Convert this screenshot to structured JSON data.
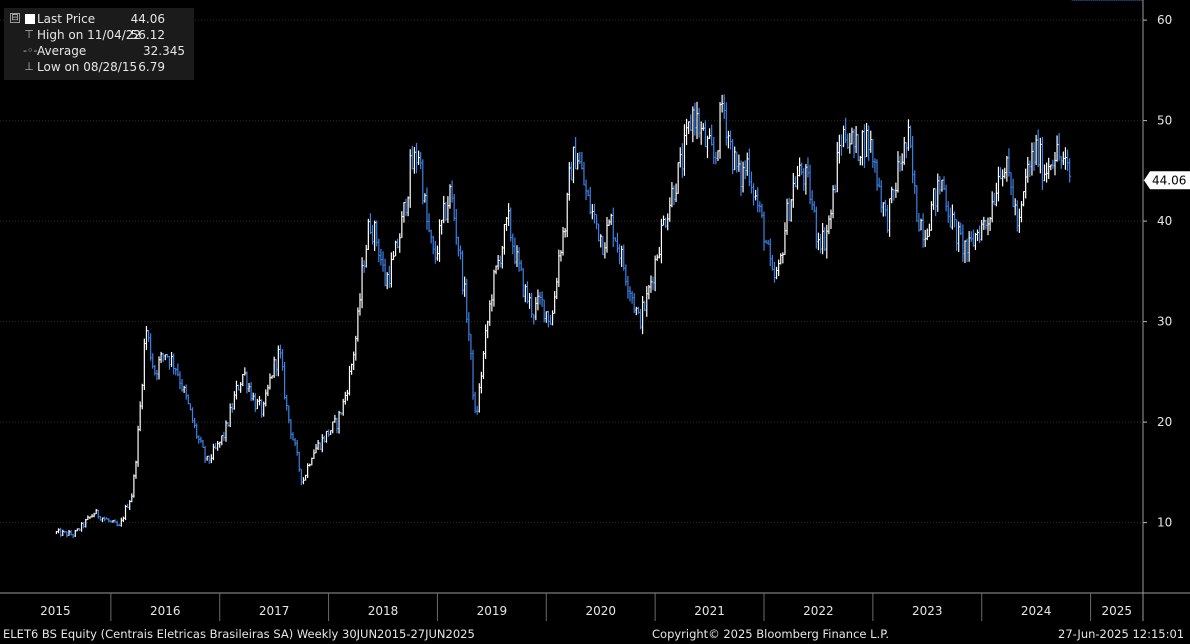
{
  "legend": {
    "items": [
      {
        "label": "Last Price",
        "value": "44.06"
      },
      {
        "label": "High on 11/04/22",
        "value": "56.12"
      },
      {
        "label": "Average",
        "value": "32.345"
      },
      {
        "label": "Low on 08/28/15",
        "value": "6.79"
      }
    ],
    "collapse_symbol": "⊟"
  },
  "footer": {
    "left": "ELET6 BS Equity (Centrais Eletricas Brasileiras SA)  Weekly 30JUN2015-27JUN2025",
    "center": "Copyright© 2025 Bloomberg Finance L.P.",
    "right": "27-Jun-2025 12:15:01"
  },
  "colors": {
    "background": "#000000",
    "up_bar": "#ffffff",
    "down_bar": "#3b82e6",
    "grid": "#2a2a2a",
    "last_price_tag": "#ffffff"
  },
  "chart_data": {
    "type": "line",
    "subtype": "weekly-hlc-bars",
    "title": "",
    "xlabel": "",
    "ylabel": "",
    "ylim": [
      3,
      62
    ],
    "y_ticks": [
      10,
      20,
      30,
      40,
      50,
      60
    ],
    "y_axis_side": "right",
    "grid": true,
    "x_tick_labels": [
      "2015",
      "2016",
      "2017",
      "2018",
      "2019",
      "2020",
      "2021",
      "2022",
      "2023",
      "2024",
      "2025"
    ],
    "last_price_label": "44.06",
    "series": [
      {
        "name": "Last Price",
        "x_decimal_year": [
          2015.5,
          2015.66,
          2015.85,
          2016.0,
          2016.08,
          2016.14,
          2016.2,
          2016.26,
          2016.32,
          2016.4,
          2016.5,
          2016.6,
          2016.7,
          2016.78,
          2016.88,
          2016.98,
          2017.05,
          2017.15,
          2017.22,
          2017.32,
          2017.4,
          2017.48,
          2017.55,
          2017.62,
          2017.68,
          2017.76,
          2017.85,
          2017.93,
          2018.0,
          2018.08,
          2018.14,
          2018.2,
          2018.26,
          2018.32,
          2018.38,
          2018.45,
          2018.52,
          2018.6,
          2018.68,
          2018.75,
          2018.83,
          2018.9,
          2018.97,
          2019.05,
          2019.12,
          2019.2,
          2019.28,
          2019.35,
          2019.45,
          2019.5,
          2019.58,
          2019.65,
          2019.73,
          2019.8,
          2019.88,
          2019.95,
          2020.05,
          2020.12,
          2020.18,
          2020.22,
          2020.28,
          2020.38,
          2020.45,
          2020.52,
          2020.6,
          2020.7,
          2020.78,
          2020.85,
          2020.92,
          2020.98,
          2021.08,
          2021.16,
          2021.25,
          2021.35,
          2021.45,
          2021.55,
          2021.62,
          2021.7,
          2021.78,
          2021.85,
          2021.93,
          2022.0,
          2022.08,
          2022.14,
          2022.2,
          2022.28,
          2022.35,
          2022.42,
          2022.48,
          2022.55,
          2022.62,
          2022.7,
          2022.76,
          2022.84,
          2022.9,
          2022.97,
          2023.05,
          2023.12,
          2023.18,
          2023.25,
          2023.33,
          2023.4,
          2023.48,
          2023.56,
          2023.64,
          2023.72,
          2023.8,
          2023.88,
          2023.96,
          2024.05,
          2024.12,
          2024.18,
          2024.26,
          2024.34,
          2024.42,
          2024.5,
          2024.58,
          2024.66,
          2024.74,
          2024.82,
          2024.9,
          2024.98,
          2025.05,
          2025.12,
          2025.2,
          2025.28,
          2025.36,
          2025.42,
          2025.48
        ],
        "y": [
          9,
          8.8,
          11,
          10,
          9.5,
          11.5,
          13,
          20,
          29.5,
          25,
          27,
          25.5,
          22,
          19,
          16,
          17.5,
          19,
          23,
          25,
          22,
          21,
          25,
          27,
          21,
          18,
          14,
          17,
          18,
          19,
          20,
          22,
          25,
          29,
          36,
          40,
          38,
          34,
          36,
          40,
          45,
          47,
          40,
          36,
          40,
          43,
          37,
          30,
          20,
          29,
          33,
          37,
          40,
          36,
          33,
          31,
          32,
          30,
          37,
          40,
          45,
          47,
          42,
          40,
          38,
          40,
          36,
          33,
          30,
          32,
          35,
          40,
          43,
          46,
          51,
          48,
          46,
          52,
          47,
          44,
          46,
          42,
          39,
          34,
          35,
          40,
          44,
          45,
          43,
          39,
          38,
          41,
          48,
          49,
          47,
          48,
          48,
          44,
          40,
          42,
          46,
          48,
          41,
          39,
          42,
          44,
          40,
          38,
          37,
          39,
          40,
          43,
          46,
          44,
          39,
          45,
          47,
          45,
          47,
          46,
          44.06
        ],
        "high": 56.12,
        "low": 6.79,
        "average": 32.345
      }
    ]
  }
}
